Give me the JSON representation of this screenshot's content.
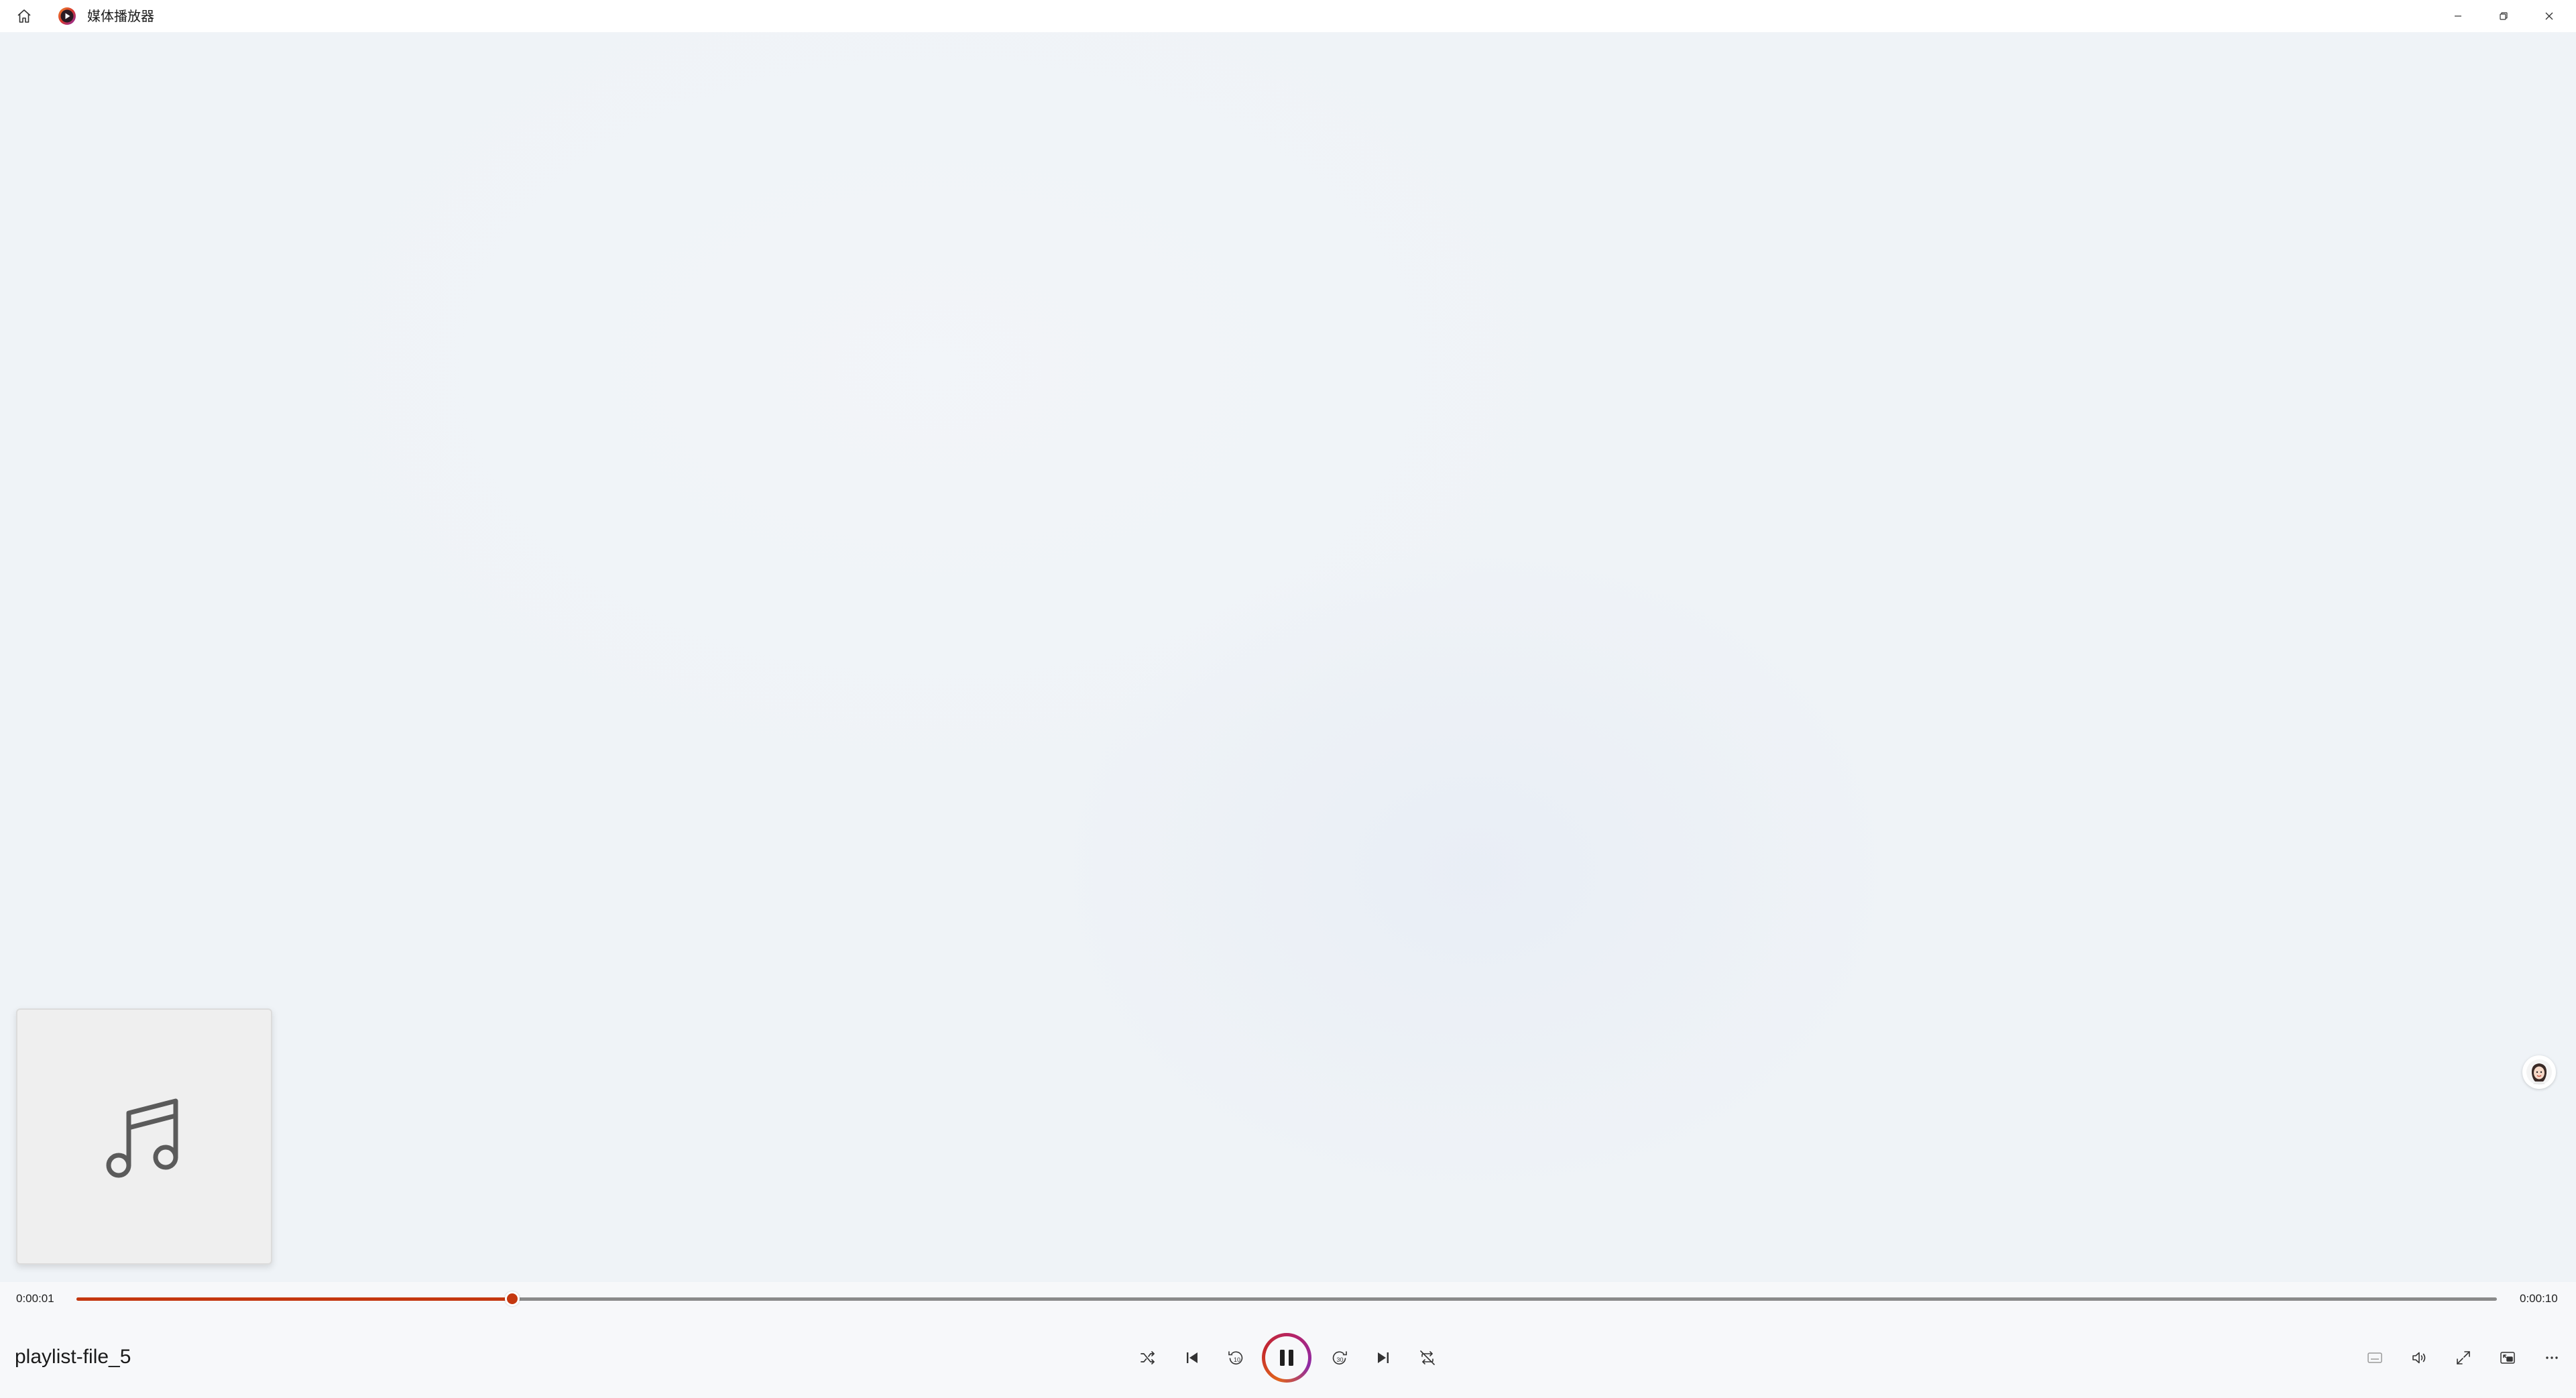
{
  "window": {
    "title": "媒体播放器"
  },
  "titlebar": {
    "icons": {
      "home": "home-icon",
      "app_logo": "media-player-logo",
      "minimize": "minimize-icon",
      "maximize": "restore-icon",
      "close": "close-icon"
    }
  },
  "now_playing": {
    "title": "playlist-file_5",
    "album_art_icon": "music-note-icon"
  },
  "playback": {
    "current_time": "0:00:01",
    "total_time": "0:00:10",
    "progress_fraction": 0.18
  },
  "controls": {
    "shuffle": "shuffle-icon",
    "previous": "previous-icon",
    "rewind": "rewind-10-icon",
    "play_pause": "pause-icon",
    "forward": "forward-30-icon",
    "next": "next-icon",
    "repeat": "repeat-off-icon",
    "captions": "captions-icon",
    "volume": "volume-icon",
    "fullscreen": "fullscreen-icon",
    "mini_player": "mini-player-icon",
    "more": "more-options-icon"
  },
  "colors": {
    "accent": "#c4370f",
    "background": "#eff3f8",
    "track": "#8a8a8a"
  }
}
